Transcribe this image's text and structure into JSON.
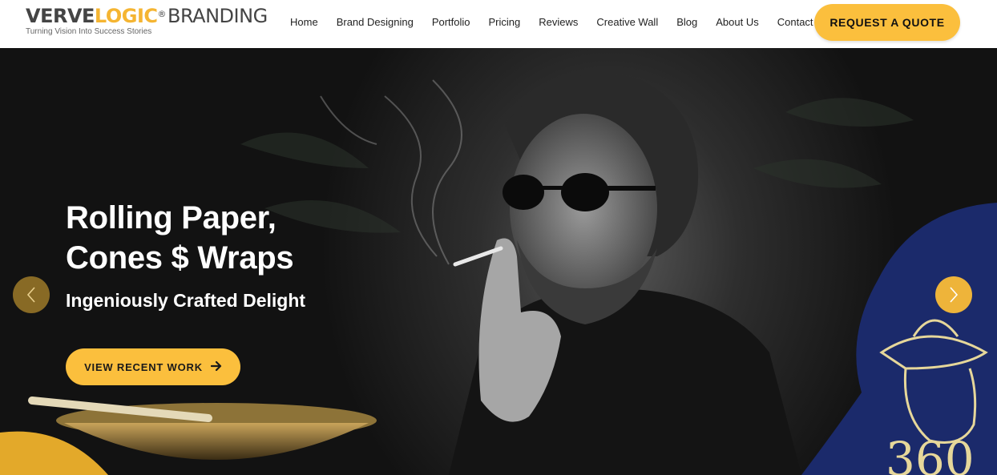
{
  "brand": {
    "logo_part1": "VERVE",
    "logo_part2": "LOGIC",
    "logo_reg": "®",
    "logo_part3": "BRANDING",
    "tagline": "Turning Vision Into Success Stories",
    "accent_color": "#fbbf3d"
  },
  "nav": {
    "items": [
      {
        "label": "Home"
      },
      {
        "label": "Brand Designing"
      },
      {
        "label": "Portfolio"
      },
      {
        "label": "Pricing"
      },
      {
        "label": "Reviews"
      },
      {
        "label": "Creative Wall"
      },
      {
        "label": "Blog"
      },
      {
        "label": "About Us"
      },
      {
        "label": "Contact Us"
      }
    ],
    "quote_label": "REQUEST A QUOTE"
  },
  "hero": {
    "title_line1": "Rolling Paper,",
    "title_line2": "Cones $ Wraps",
    "subtitle": "Ingeniously Crafted Delight",
    "cta_label": "VIEW RECENT WORK",
    "cta_icon": "arrow-right-icon",
    "prev_icon": "chevron-left-icon",
    "next_icon": "chevron-right-icon",
    "badge_text": "360",
    "navy_color": "#1b2a6b"
  }
}
